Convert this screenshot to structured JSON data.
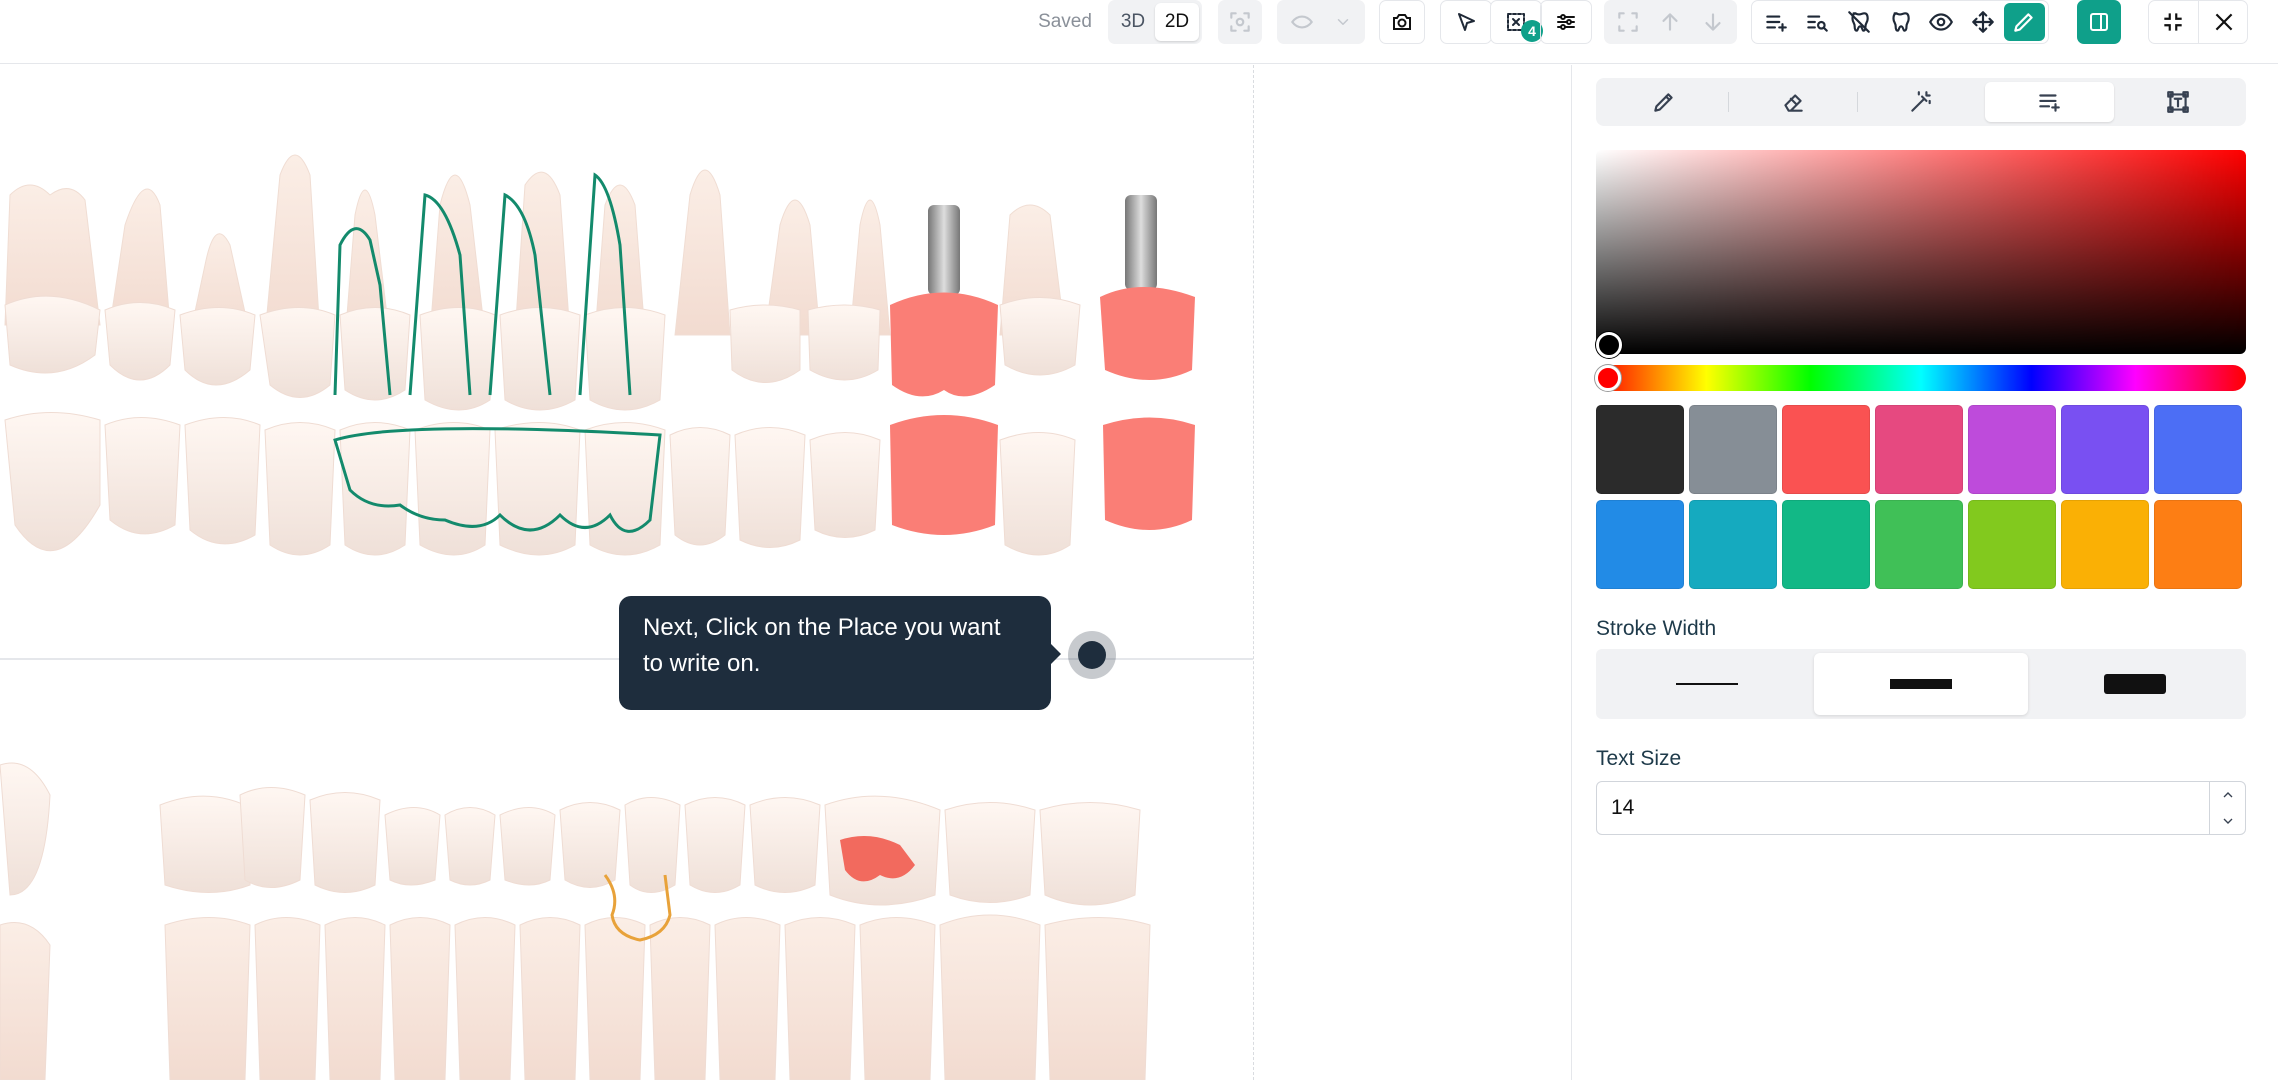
{
  "toolbar": {
    "saved_label": "Saved",
    "view_modes": [
      "3D",
      "2D"
    ],
    "active_view": "2D",
    "selection_count": "4",
    "accent_color": "#0fa08a",
    "icons": [
      "focus-icon",
      "visibility-icon",
      "chevron-down-icon",
      "camera-icon",
      "pointer-icon",
      "select-multiple-icon",
      "sliders-icon",
      "frame-icon",
      "arrow-up-icon",
      "arrow-down-icon",
      "add-note-icon",
      "search-list-icon",
      "tooth-off-icon",
      "tooth-heart-icon",
      "eye-icon",
      "move-icon",
      "pencil-icon",
      "sidebar-toggle-icon",
      "minimize-icon",
      "close-icon"
    ]
  },
  "tooltip": {
    "text": "Next, Click on the Place you want to write on."
  },
  "panel": {
    "tools": [
      "pencil-icon",
      "eraser-icon",
      "magic-wand-icon",
      "text-add-icon",
      "text-box-icon"
    ],
    "active_tool": "text-add-icon",
    "swatches": [
      "#2b2b2b",
      "#868e96",
      "#fa5252",
      "#e64980",
      "#be4bdb",
      "#7950f2",
      "#4c6ef5",
      "#228be6",
      "#15aabf",
      "#12b886",
      "#40c057",
      "#82c91e",
      "#fab005",
      "#fd7e14"
    ],
    "selected_color": "#000000",
    "hue_color": "#ff0000",
    "stroke_width_label": "Stroke Width",
    "stroke_widths": [
      "thin",
      "medium",
      "thick"
    ],
    "active_stroke": "medium",
    "text_size_label": "Text Size",
    "text_size_value": "14"
  }
}
